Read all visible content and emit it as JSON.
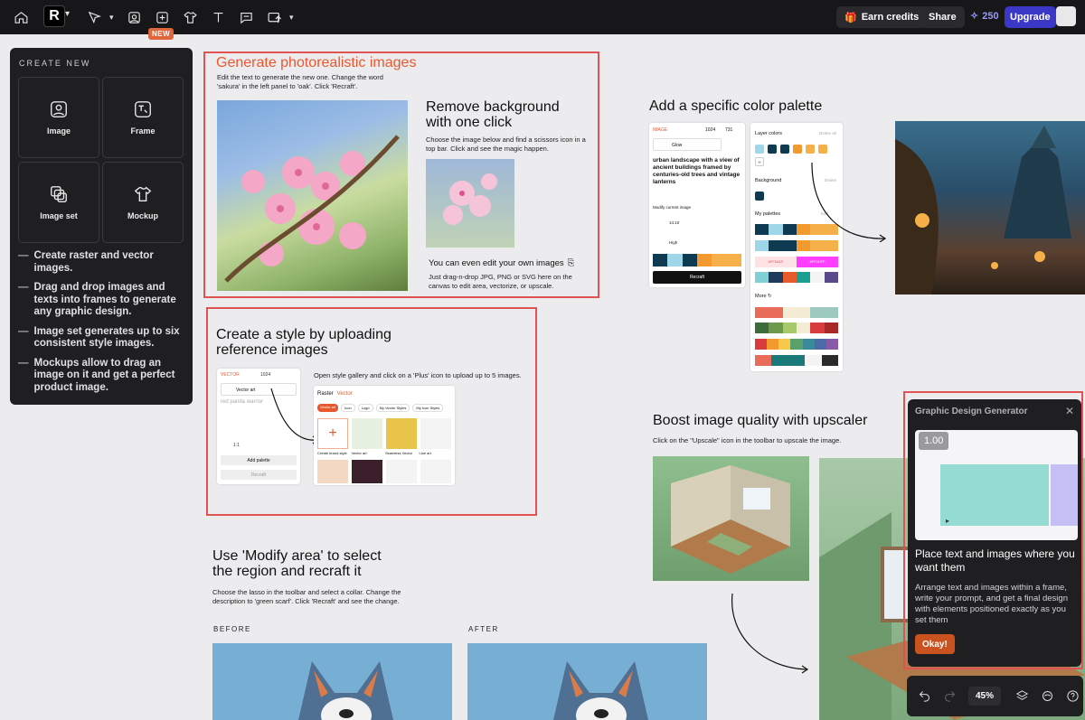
{
  "toolbar": {
    "new_badge": "NEW",
    "earn_credits": "Earn credits",
    "share": "Share",
    "credits": "250",
    "upgrade": "Upgrade",
    "logo": "R"
  },
  "left_panel": {
    "title": "CREATE NEW",
    "tiles": [
      {
        "label": "Image",
        "icon": "image-icon"
      },
      {
        "label": "Frame",
        "icon": "frame-icon"
      },
      {
        "label": "Image set",
        "icon": "image-set-icon"
      },
      {
        "label": "Mockup",
        "icon": "tshirt-icon"
      }
    ],
    "bullets": [
      "Create raster and vector images.",
      "Drag and drop images and texts into frames to generate any graphic design.",
      "Image set generates up to six consistent style images.",
      "Mockups allow to drag an image on it and get a perfect product image."
    ]
  },
  "canvas": {
    "photoreal": {
      "title": "Generate photorealistic images",
      "desc": "Edit the text to generate the new one. Change the word 'sakura' in the left panel to 'oak'. Click 'Recraft'."
    },
    "remove_bg": {
      "title": "Remove background with one click",
      "desc": "Choose the image below and find a scissors icon in a top bar. Click and see the magic happen.",
      "edit_title": "You can even edit your own images",
      "edit_desc": "Just drag-n-drop JPG, PNG or SVG here on the canvas to edit area, vectorize, or upscale."
    },
    "palette": {
      "title": "Add a specific color palette",
      "mini_tab": "IMAGE",
      "mini_size_w": "1024",
      "mini_size_h": "731",
      "mini_style": "Glow",
      "mini_prompt": "urban landscape with a view of ancient buildings framed by centuries-old trees and vintage lanterns",
      "mini_modify": "Modify current image",
      "mini_ratio": "14:10",
      "mini_quality": "High",
      "mini_recraft": "Recraft",
      "layer_colors": "Layer colors",
      "background": "Background",
      "my_palettes": "My palettes",
      "more": "More",
      "delete_all": "Delete all",
      "delete": "Delete",
      "edit": "Edit",
      "hex1": "#FF5A1F",
      "hex2": "#FF3DFF"
    },
    "style": {
      "title": "Create a style by uploading reference images",
      "desc": "Open style gallery and click on a 'Plus' icon to upload up to 5 images.",
      "mini_tab": "VECTOR",
      "mini_size": "1024",
      "mini_style": "Vector art",
      "mini_prompt": "red panda warrior",
      "mini_ratio": "1:1",
      "add_palette": "Add palette",
      "recraft": "Recraft",
      "gallery_tabs": [
        "Raster",
        "Vector"
      ],
      "chips": [
        "Vector art",
        "Icon",
        "Logo",
        "My Vector Styles",
        "My Icon Styles"
      ],
      "cells": [
        "Create brand style",
        "Vector art",
        "Seamless Vector",
        "Line art"
      ]
    },
    "upscaler": {
      "title": "Boost image quality with upscaler",
      "desc": "Click on the \"Upscale\" icon in the toolbar to upscale the image."
    },
    "modify": {
      "title": "Use 'Modify area' to select the region and recraft it",
      "desc": "Choose the lasso in the toolbar and select a collar. Change the description to 'green scarf'. Click 'Recraft' and see the change.",
      "before": "BEFORE",
      "after": "AFTER"
    }
  },
  "popup": {
    "header": "Graphic Design Generator",
    "zoom": "1.00",
    "title": "Place text and images where you want them",
    "desc": "Arrange text and images within a frame, write your prompt, and get a final design with elements positioned exactly as you set them",
    "ok": "Okay!"
  },
  "bottom_tools": {
    "zoom": "45%"
  }
}
